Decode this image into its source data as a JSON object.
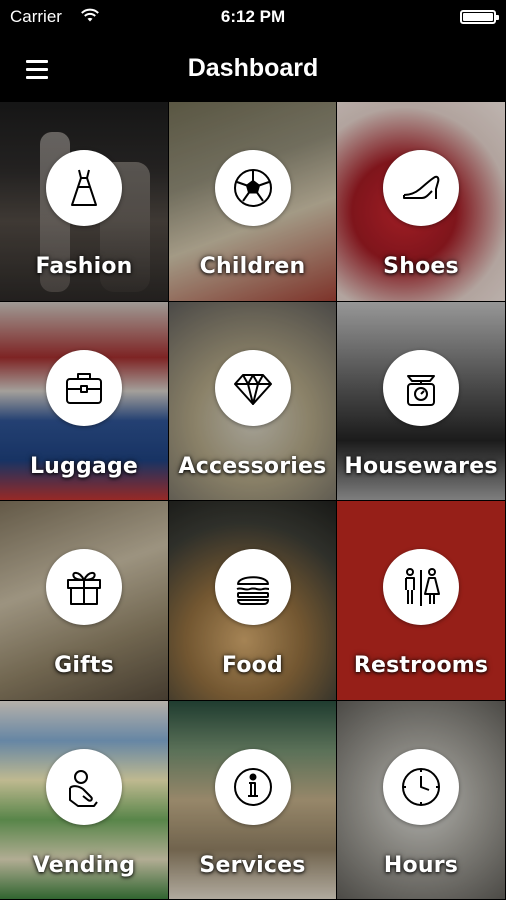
{
  "status_bar": {
    "carrier": "Carrier",
    "time": "6:12 PM"
  },
  "nav": {
    "title": "Dashboard"
  },
  "tiles": [
    {
      "label": "Fashion",
      "icon": "dress-icon"
    },
    {
      "label": "Children",
      "icon": "soccer-ball-icon"
    },
    {
      "label": "Shoes",
      "icon": "high-heel-icon"
    },
    {
      "label": "Luggage",
      "icon": "briefcase-icon"
    },
    {
      "label": "Accessories",
      "icon": "diamond-icon"
    },
    {
      "label": "Housewares",
      "icon": "kitchen-scale-icon"
    },
    {
      "label": "Gifts",
      "icon": "gift-icon"
    },
    {
      "label": "Food",
      "icon": "burger-icon"
    },
    {
      "label": "Restrooms",
      "icon": "restroom-icon"
    },
    {
      "label": "Vending",
      "icon": "hand-coin-icon"
    },
    {
      "label": "Services",
      "icon": "info-icon"
    },
    {
      "label": "Hours",
      "icon": "clock-icon"
    }
  ],
  "colors": {
    "nav_background": "#000000",
    "label_text": "#ffffff",
    "icon_circle": "#ffffff"
  }
}
